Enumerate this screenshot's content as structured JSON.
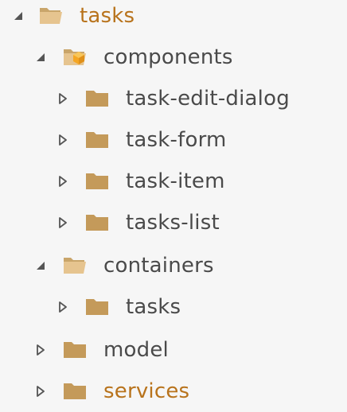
{
  "tree": {
    "items": [
      {
        "label": "tasks",
        "state": "expanded",
        "icon": "folder-open-icon",
        "modified": true
      },
      {
        "label": "components",
        "state": "expanded",
        "icon": "folder-components-icon",
        "modified": false
      },
      {
        "label": "task-edit-dialog",
        "state": "collapsed",
        "icon": "folder-icon",
        "modified": false
      },
      {
        "label": "task-form",
        "state": "collapsed",
        "icon": "folder-icon",
        "modified": false
      },
      {
        "label": "task-item",
        "state": "collapsed",
        "icon": "folder-icon",
        "modified": false
      },
      {
        "label": "tasks-list",
        "state": "collapsed",
        "icon": "folder-icon",
        "modified": false
      },
      {
        "label": "containers",
        "state": "expanded",
        "icon": "folder-open-icon",
        "modified": false
      },
      {
        "label": "tasks",
        "state": "collapsed",
        "icon": "folder-icon",
        "modified": false
      },
      {
        "label": "model",
        "state": "collapsed",
        "icon": "folder-icon",
        "modified": false
      },
      {
        "label": "services",
        "state": "collapsed",
        "icon": "folder-icon",
        "modified": true
      }
    ]
  },
  "colors": {
    "background": "#f6f6f6",
    "text": "#4a4a4a",
    "modified_text": "#b8731c",
    "folder": "#c49a5a",
    "folder_open": "#e6c48f",
    "arrow": "#555555"
  }
}
